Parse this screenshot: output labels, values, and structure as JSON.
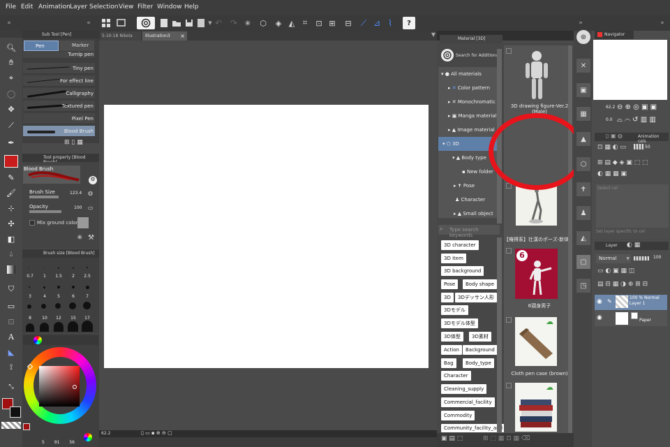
{
  "menu": [
    "File",
    "Edit",
    "Animation",
    "Layer",
    "Selection",
    "View",
    "Filter",
    "Window",
    "Help"
  ],
  "subtool_panel": {
    "title": "Sub Tool [Pen]",
    "tabs": [
      "Pen",
      "Marker"
    ],
    "brushes": [
      "Turnip pen",
      "Tiny pen",
      "For effect line",
      "Calligraphy",
      "Textured pen",
      "Pixel Pen",
      "Blood Brush"
    ]
  },
  "tool_property": {
    "title": "Tool property [Blood Brush]",
    "brush_name": "Blood Brush",
    "brush_size_label": "Brush Size",
    "brush_size_value": "123.4",
    "opacity_label": "Opacity",
    "opacity_value": "100",
    "mix_label": "Mix ground color"
  },
  "brush_size_panel": {
    "title": "Brush size [Blood Brush]",
    "sizes": [
      "0.7",
      "1",
      "1.5",
      "2",
      "2.5",
      "3",
      "4",
      "5",
      "6",
      "7",
      "8",
      "10",
      "12",
      "15",
      "17"
    ]
  },
  "color": {
    "main": "#a01010",
    "hsv_readout": [
      "5",
      "91",
      "56"
    ]
  },
  "documents": {
    "tabs": [
      "5-10-18 Nikola",
      "Illustration3"
    ],
    "zoom": "62.2"
  },
  "material_panel": {
    "title": "Material [3D]",
    "search_label": "Search for Additional Materials",
    "tree": [
      "All materials",
      "Color pattern",
      "Monochromatic pattern",
      "Manga material",
      "Image material",
      "3D",
      "Body type",
      "New folder",
      "Pose",
      "Character",
      "Small object"
    ],
    "keyword_placeholder": "Type search keywords",
    "tags": [
      "3D character",
      "3D item",
      "3D background",
      "Pose",
      "Body shape",
      "3D",
      "3Dデッサン人形",
      "3Dモデル",
      "3Dモデル体型",
      "3D体型",
      "3D素材",
      "Action",
      "Background",
      "Bag",
      "Body_type",
      "Character",
      "Cleaning_supply",
      "Commercial_facility",
      "Commodity",
      "Community_facility_and"
    ],
    "items": [
      "3D drawing figure-Ver.2 (Male)",
      "【俺得系】壮漢のポーズ-新体操",
      "6頭身男子",
      "Cloth pen case (brown)"
    ],
    "badge": "6"
  },
  "navigator": {
    "title": "Navigator",
    "zoom": "62.2",
    "angle": "0.0"
  },
  "animation_panel": {
    "title": "Animation cels",
    "value": "50",
    "placeholder1": "Select cel",
    "placeholder2": "Set layer specific to cel"
  },
  "layer_panel": {
    "title": "Layer",
    "blend_mode": "Normal",
    "opacity": "100",
    "layers": [
      {
        "name": "100 % Normal\nLayer 1"
      },
      {
        "name": "Paper"
      }
    ]
  },
  "annotation": {
    "color": "#e8141b"
  }
}
